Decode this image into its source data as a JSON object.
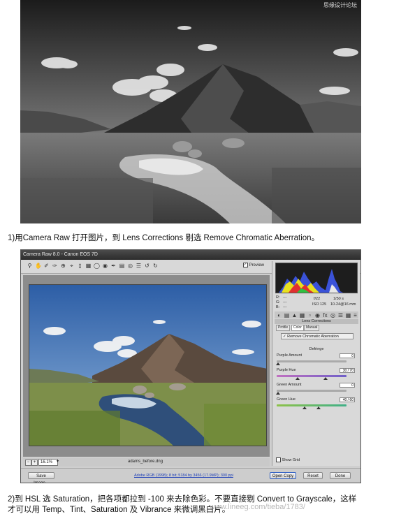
{
  "watermark_top": "思缘设计论坛",
  "step1_text": "1)用Camera Raw 打开图片，到 Lens Corrections 剔选 Remove Chromatic Aberration。",
  "camera_raw": {
    "title": "Camera Raw 8.0  -  Canon EOS 7D",
    "preview_label": "Preview",
    "camera_info": {
      "r_label": "R:",
      "g_label": "G:",
      "b_label": "B:",
      "r_value": "---",
      "g_value": "---",
      "b_value": "---",
      "aperture": "f/22",
      "shutter": "1/50 s",
      "iso": "ISO 125",
      "focal": "10-24@16 mm"
    },
    "panel_title": "Lens Corrections",
    "tabs": [
      "Profile",
      "Color",
      "Manual"
    ],
    "remove_ca_label": "Remove Chromatic Aberration",
    "defringe_label": "Defringe",
    "sliders": [
      {
        "label": "Purple Amount",
        "value": "0",
        "colors": [
          "#aaaaaa",
          "#aaaaaa"
        ],
        "thumbs": [
          0.02
        ]
      },
      {
        "label": "Purple Hue",
        "value": "30 / 70",
        "colors": [
          "#c070c0",
          "#7060c8"
        ],
        "thumbs": [
          0.3,
          0.7
        ]
      },
      {
        "label": "Green Amount",
        "value": "0",
        "colors": [
          "#aaaaaa",
          "#aaaaaa"
        ],
        "thumbs": [
          0.02
        ]
      },
      {
        "label": "Green Hue",
        "value": "40 / 60",
        "colors": [
          "#8ec24a",
          "#40b088"
        ],
        "thumbs": [
          0.4,
          0.6
        ]
      }
    ],
    "show_grid_label": "Show Grid",
    "zoom_value": "16.1%",
    "filename": "adams_before.dng",
    "save_image_label": "Save Image...",
    "workflow_link": "Adobe RGB (1998); 8 bit; 5184 by 3456 (17.9MP); 300 ppi",
    "open_copy_label": "Open Copy",
    "reset_label": "Reset",
    "done_label": "Done"
  },
  "step2_line1": "2)到 HSL 选 Saturation，把各项都拉到 -100 来去除色彩。不要直接剔 Convert to Grayscale，这样",
  "step2_line2": "才可以用 Temp、Tint、Saturation 及 Vibrance 来微调黑白片。",
  "watermark_bottom": "www.lineeg.com/tieba/1783/"
}
